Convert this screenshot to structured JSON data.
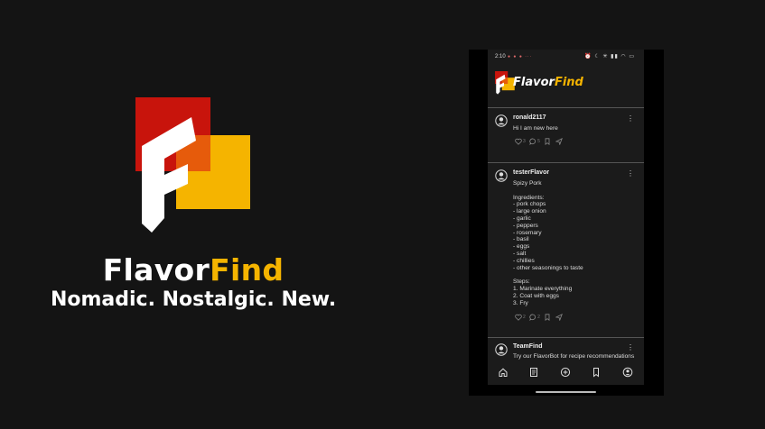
{
  "brand": {
    "name_part1": "Flavor",
    "name_part2": "Find",
    "tagline": "Nomadic. Nostalgic. New.",
    "colors": {
      "red": "#c8140c",
      "gold": "#f5b400",
      "orange": "#e65b0b",
      "white": "#ffffff"
    }
  },
  "status_bar": {
    "time": "2:10",
    "notification_dots": "● ● ● ···",
    "icons": "⏰ ☾ ✳ ▮▮ ◠ ▭"
  },
  "app": {
    "title_part1": "Flavor",
    "title_part2": "Find"
  },
  "posts": [
    {
      "username": "ronald2117",
      "text": "Hi I am new here",
      "likes": "3",
      "comments": "5"
    },
    {
      "username": "testerFlavor",
      "text": "Spizy Pork\n\nIngredients:\n- pork chops\n- large onion\n- garlic\n- peppers\n- rosemary\n- basil\n- eggs\n- salt\n- chillies\n- other seasonings to taste\n\nSteps:\n1. Marinate everything\n2. Coat with eggs\n3. Fry",
      "likes": "2",
      "comments": "2"
    },
    {
      "username": "TeamFind",
      "text": "Try our FlavorBot for recipe recommendations"
    }
  ],
  "bottom_nav": [
    "home-icon",
    "recipe-book-icon",
    "add-icon",
    "bookmark-icon",
    "profile-icon"
  ]
}
